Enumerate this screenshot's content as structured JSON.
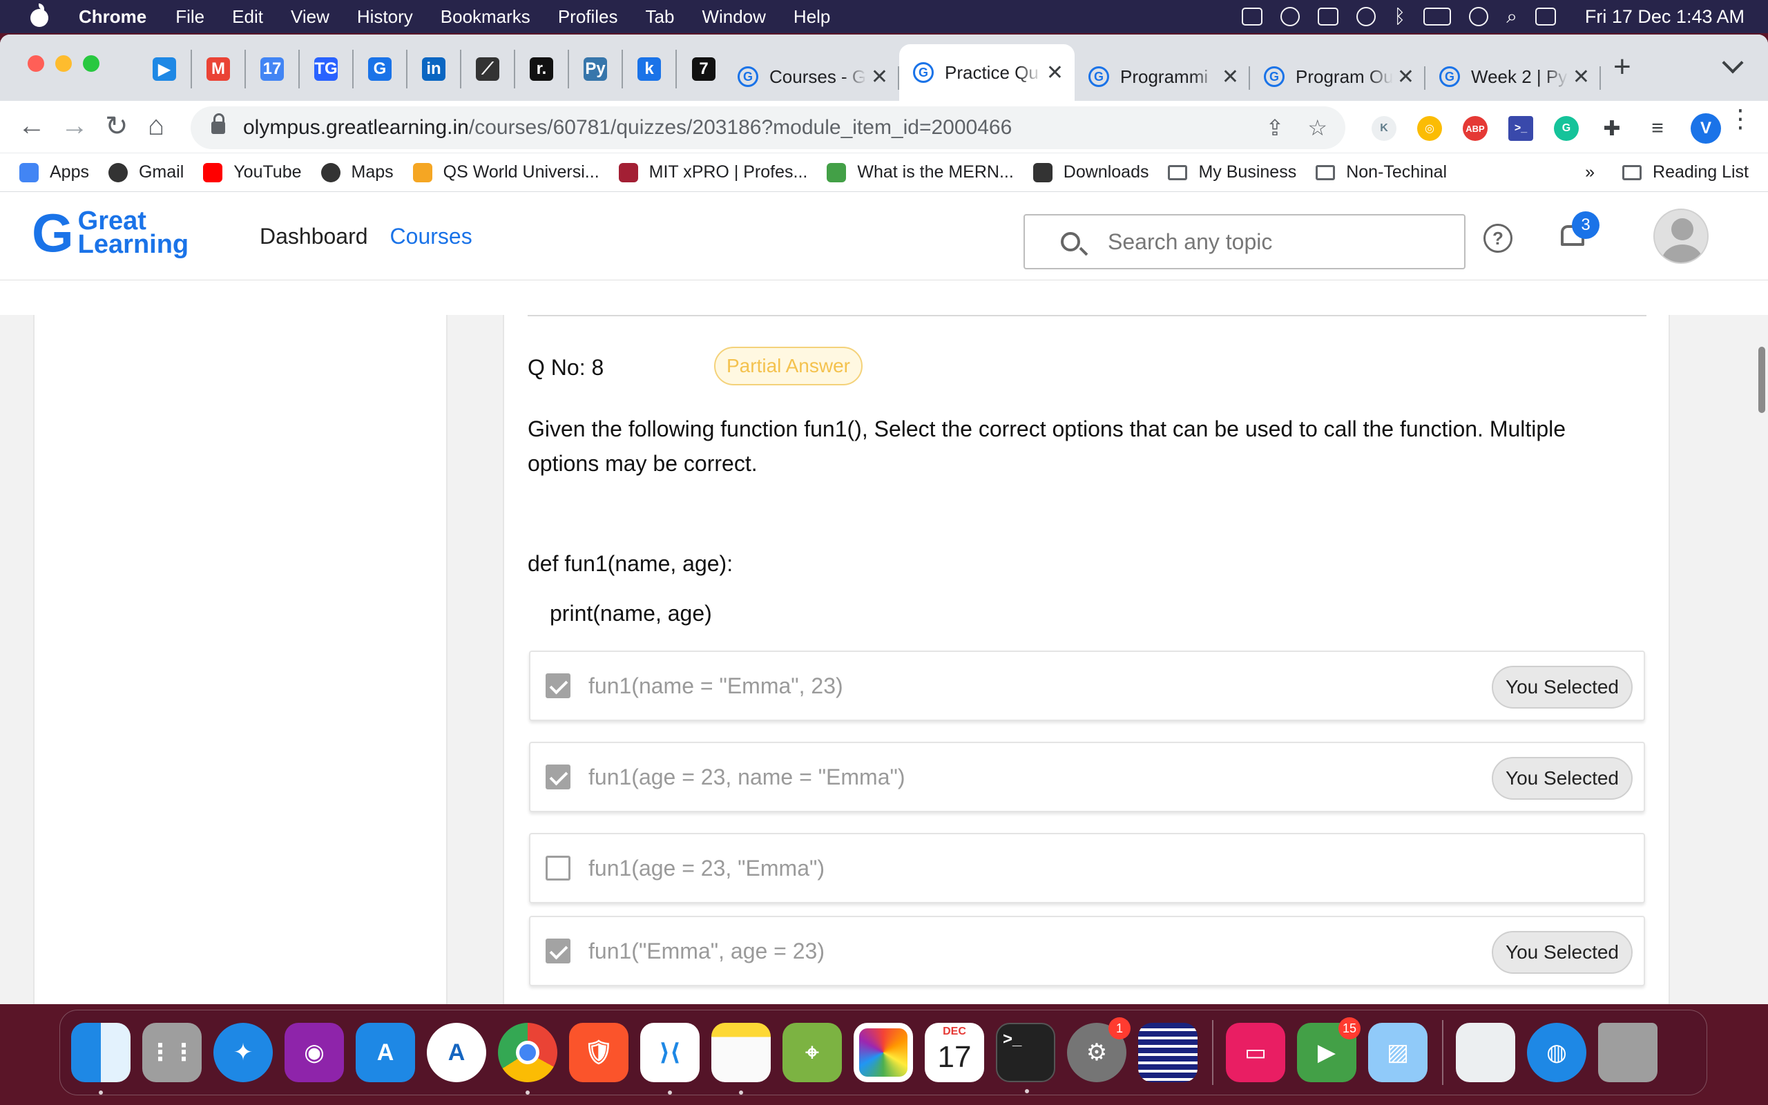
{
  "menubar": {
    "app_name": "Chrome",
    "items": [
      "File",
      "Edit",
      "View",
      "History",
      "Bookmarks",
      "Profiles",
      "Tab",
      "Window",
      "Help"
    ],
    "clock": "Fri 17 Dec  1:43 AM"
  },
  "browser": {
    "pinned_tabs": [
      {
        "icon": "play-icon",
        "color": "#1e88e5",
        "glyph": "▶"
      },
      {
        "icon": "gmail-icon",
        "color": "#ea4335",
        "glyph": "M"
      },
      {
        "icon": "calendar-icon",
        "color": "#4285f4",
        "glyph": "17"
      },
      {
        "icon": "tg-icon",
        "color": "#2962ff",
        "glyph": "TG"
      },
      {
        "icon": "g-icon",
        "color": "#1a73e8",
        "glyph": "G"
      },
      {
        "icon": "linkedin-icon",
        "color": "#0a66c2",
        "glyph": "in"
      },
      {
        "icon": "feather-icon",
        "color": "#333333",
        "glyph": "⟋"
      },
      {
        "icon": "r-icon",
        "color": "#111111",
        "glyph": "r."
      },
      {
        "icon": "python-icon",
        "color": "#3776ab",
        "glyph": "Py"
      },
      {
        "icon": "k-icon",
        "color": "#1a73e8",
        "glyph": "k"
      },
      {
        "icon": "seven-icon",
        "color": "#111111",
        "glyph": "7"
      }
    ],
    "tabs": [
      {
        "title": "Courses - Gr",
        "active": false
      },
      {
        "title": "Practice Qu",
        "active": true
      },
      {
        "title": "Programmi",
        "active": false
      },
      {
        "title": "Program Ou",
        "active": false
      },
      {
        "title": "Week 2 | Py",
        "active": false
      }
    ],
    "url_host": "olympus.greatlearning.in",
    "url_path": "/courses/60781/quizzes/203186?module_item_id=2000466",
    "profile_initial": "V",
    "bookmarks": [
      {
        "label": "Apps",
        "icon": "apps-grid-icon",
        "color": "#4285f4"
      },
      {
        "label": "Gmail",
        "icon": "globe-icon",
        "color": "#333333"
      },
      {
        "label": "YouTube",
        "icon": "youtube-icon",
        "color": "#ff0000"
      },
      {
        "label": "Maps",
        "icon": "globe-icon",
        "color": "#333333"
      },
      {
        "label": "QS World Universi...",
        "icon": "qs-icon",
        "color": "#f5a623"
      },
      {
        "label": "MIT xPRO | Profes...",
        "icon": "mit-icon",
        "color": "#a31f34"
      },
      {
        "label": "What is the MERN...",
        "icon": "leaf-icon",
        "color": "#43a047"
      },
      {
        "label": "Downloads",
        "icon": "download-icon",
        "color": "#333333"
      },
      {
        "label": "My Business",
        "icon": "folder-icon",
        "color": "folder"
      },
      {
        "label": "Non-Techinal",
        "icon": "folder-icon",
        "color": "folder"
      }
    ],
    "bookmarks_more": "»",
    "reading_list": "Reading List"
  },
  "site": {
    "logo_line1": "Great",
    "logo_line2": "Learning",
    "nav_dashboard": "Dashboard",
    "nav_courses": "Courses",
    "search_placeholder": "Search any topic",
    "notification_count": "3"
  },
  "quiz": {
    "question_number": "Q No: 8",
    "status": "Partial Answer",
    "question": "Given the following function fun1(), Select the correct options that can be used to call the function. Multiple options may be correct.",
    "code_line1": "def fun1(name, age):",
    "code_line2": "print(name, age)",
    "options": [
      {
        "text": "fun1(name = \"Emma\", 23)",
        "selected": true,
        "badge": "You Selected"
      },
      {
        "text": "fun1(age = 23, name = \"Emma\")",
        "selected": true,
        "badge": "You Selected"
      },
      {
        "text": "fun1(age = 23, \"Emma\")",
        "selected": false,
        "badge": ""
      },
      {
        "text": "fun1(\"Emma\", age = 23)",
        "selected": true,
        "badge": "You Selected"
      }
    ]
  },
  "dock": {
    "calendar_month": "DEC",
    "calendar_day": "17",
    "badges": {
      "system_preferences": "1",
      "facetime": "15"
    }
  }
}
